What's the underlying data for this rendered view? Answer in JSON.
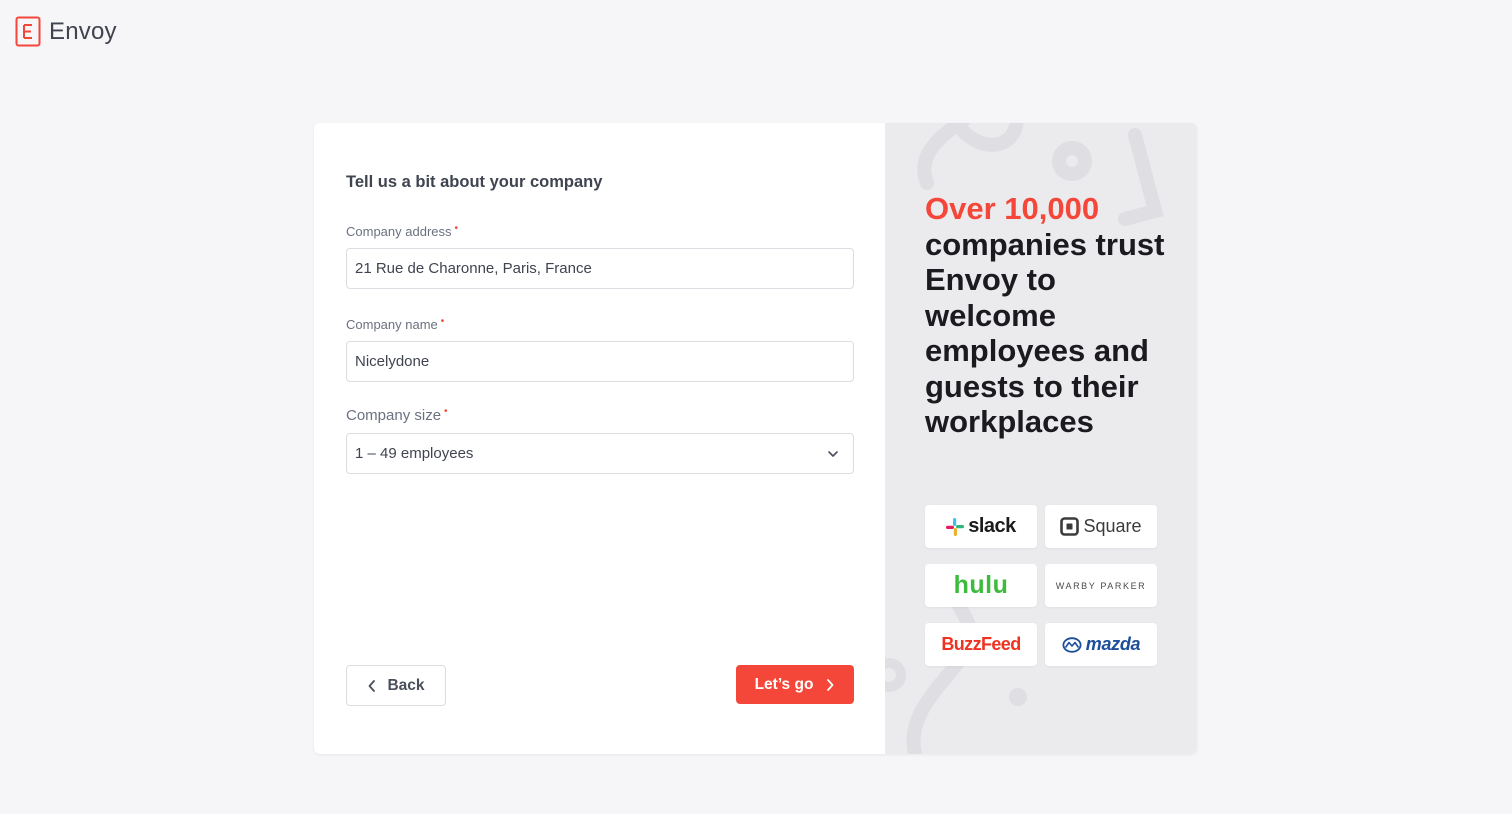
{
  "app": {
    "name": "Envoy",
    "logo_letter": "E",
    "accent_color": "#f4473a"
  },
  "form": {
    "title": "Tell us a bit about your company",
    "required_marker": "•",
    "address": {
      "label": "Company address",
      "value": "21 Rue de Charonne, Paris, France"
    },
    "name": {
      "label": "Company name",
      "value": "Nicelydone"
    },
    "size": {
      "label": "Company size",
      "selected": "1 – 49 employees"
    },
    "back_label": "Back",
    "next_label": "Let’s go"
  },
  "promo": {
    "highlight": "Over 10,000",
    "text": "companies trust Envoy to welcome employees and guests to their workplaces",
    "logos": {
      "slack": "slack",
      "square": "Square",
      "hulu": "hulu",
      "warby_parker": "WARBY PARKER",
      "buzzfeed": "BuzzFeed",
      "mazda": "mazda"
    }
  }
}
